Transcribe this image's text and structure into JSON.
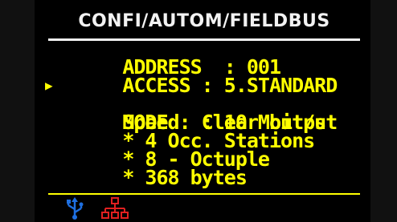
{
  "screen": {
    "title": "CONFI/AUTOM/FIELDBUS"
  },
  "menu": {
    "rows": [
      {
        "text": "ADDRESS  : 001",
        "selected": false
      },
      {
        "text": "ACCESS : 5.STANDARD",
        "selected": false
      },
      {
        "text": "Speed  : 10 Mbit/s",
        "selected": true
      },
      {
        "text": "MODE : Clear output",
        "selected": false
      },
      {
        "text": "* 4 Occ. Stations",
        "selected": false
      },
      {
        "text": "* 8 - Octuple",
        "selected": false
      },
      {
        "text": "* 368 bytes",
        "selected": false
      }
    ],
    "cursor_glyph": "▶"
  },
  "status": {
    "icons": [
      "usb-icon",
      "network-icon"
    ]
  },
  "colors": {
    "text": "#ffff00",
    "title": "#f2f2f2",
    "background": "#000000",
    "usb_icon": "#1e6fe0",
    "network_icon": "#e02020"
  }
}
